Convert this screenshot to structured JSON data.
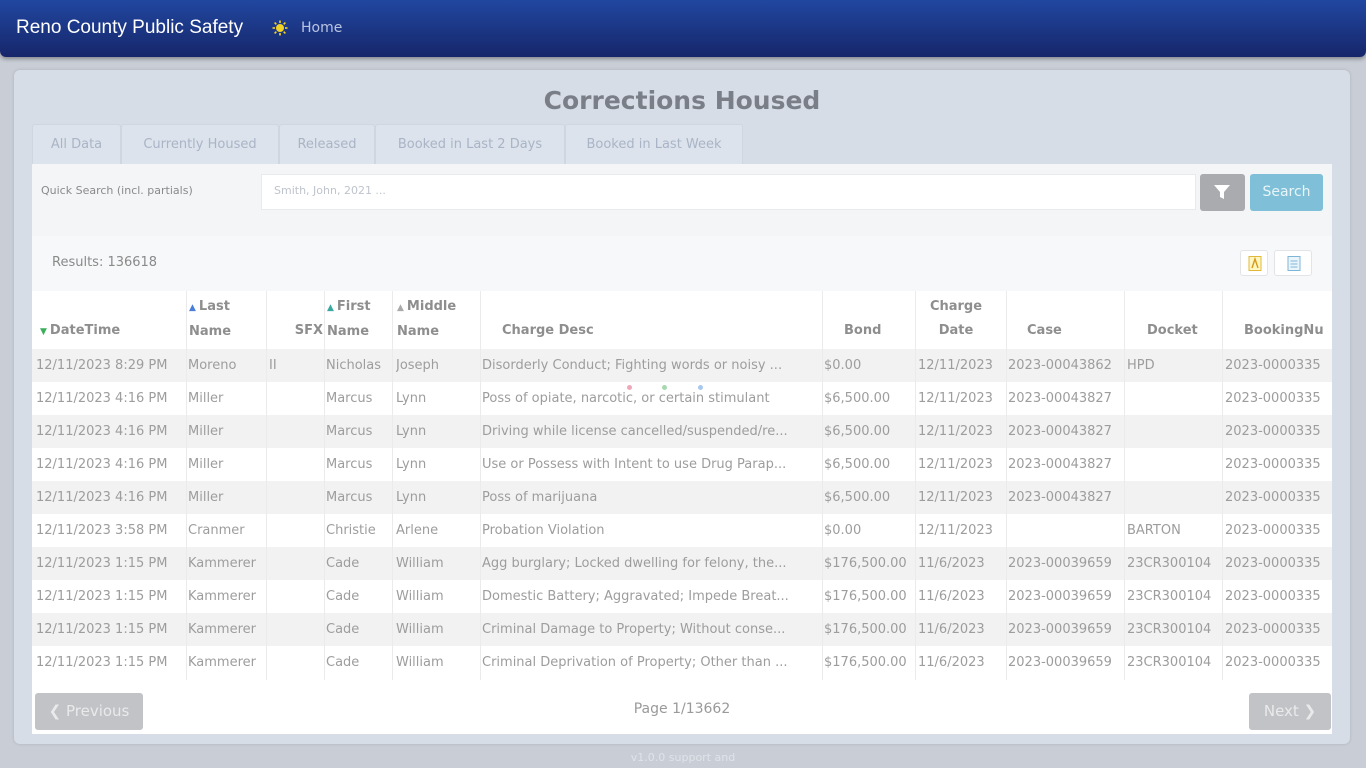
{
  "app": {
    "title": "Reno County Public Safety",
    "nav_home": "Home"
  },
  "page": {
    "title": "Corrections Housed"
  },
  "tabs": [
    "All Data",
    "Currently Housed",
    "Released",
    "Booked in Last 2 Days",
    "Booked in Last Week"
  ],
  "search": {
    "label": "Quick Search (incl. partials)",
    "placeholder": "Smith, John, 2021 ...",
    "button": "Search"
  },
  "results": {
    "label": "Results: 136618"
  },
  "table": {
    "headers": [
      "DateTime",
      "Last Name",
      "SFX",
      "First Name",
      "Middle Name",
      "Charge Desc",
      "Bond",
      "Charge Date",
      "Case",
      "Docket",
      "BookingNu"
    ],
    "rows": [
      [
        "12/11/2023 8:29 PM",
        "Moreno",
        "II",
        "Nicholas",
        "Joseph",
        "Disorderly Conduct; Fighting words or noisy ...",
        "$0.00",
        "12/11/2023",
        "2023-00043862",
        "HPD",
        "2023-0000335"
      ],
      [
        "12/11/2023 4:16 PM",
        "Miller",
        "",
        "Marcus",
        "Lynn",
        "Poss of opiate, narcotic, or certain stimulant",
        "$6,500.00",
        "12/11/2023",
        "2023-00043827",
        "",
        "2023-0000335"
      ],
      [
        "12/11/2023 4:16 PM",
        "Miller",
        "",
        "Marcus",
        "Lynn",
        "Driving while license cancelled/suspended/re...",
        "$6,500.00",
        "12/11/2023",
        "2023-00043827",
        "",
        "2023-0000335"
      ],
      [
        "12/11/2023 4:16 PM",
        "Miller",
        "",
        "Marcus",
        "Lynn",
        "Use or Possess with Intent to use Drug Parap...",
        "$6,500.00",
        "12/11/2023",
        "2023-00043827",
        "",
        "2023-0000335"
      ],
      [
        "12/11/2023 4:16 PM",
        "Miller",
        "",
        "Marcus",
        "Lynn",
        "Poss of marijuana",
        "$6,500.00",
        "12/11/2023",
        "2023-00043827",
        "",
        "2023-0000335"
      ],
      [
        "12/11/2023 3:58 PM",
        "Cranmer",
        "",
        "Christie",
        "Arlene",
        "Probation Violation",
        "$0.00",
        "12/11/2023",
        "",
        "BARTON",
        "2023-0000335"
      ],
      [
        "12/11/2023 1:15 PM",
        "Kammerer",
        "",
        "Cade",
        "William",
        "Agg burglary; Locked dwelling for felony, the...",
        "$176,500.00",
        "11/6/2023",
        "2023-00039659",
        "23CR300104",
        "2023-0000335"
      ],
      [
        "12/11/2023 1:15 PM",
        "Kammerer",
        "",
        "Cade",
        "William",
        "Domestic Battery; Aggravated; Impede Breat...",
        "$176,500.00",
        "11/6/2023",
        "2023-00039659",
        "23CR300104",
        "2023-0000335"
      ],
      [
        "12/11/2023 1:15 PM",
        "Kammerer",
        "",
        "Cade",
        "William",
        "Criminal Damage to Property; Without conse...",
        "$176,500.00",
        "11/6/2023",
        "2023-00039659",
        "23CR300104",
        "2023-0000335"
      ],
      [
        "12/11/2023 1:15 PM",
        "Kammerer",
        "",
        "Cade",
        "William",
        "Criminal Deprivation of Property; Other than ...",
        "$176,500.00",
        "11/6/2023",
        "2023-00039659",
        "23CR300104",
        "2023-0000335"
      ]
    ]
  },
  "pager": {
    "previous": "Previous",
    "next": "Next",
    "page": "Page 1/13662"
  },
  "footer": {
    "text": "v1.0.0 support and"
  },
  "colors": {
    "navbar": "#1a3a8a",
    "search_button": "#7fc0d8",
    "panel": "#d6dde7"
  },
  "icons": {
    "brand": "sun-icon",
    "filter": "filter-icon",
    "export_pdf": "pdf-export-icon",
    "export_doc": "document-export-icon"
  }
}
